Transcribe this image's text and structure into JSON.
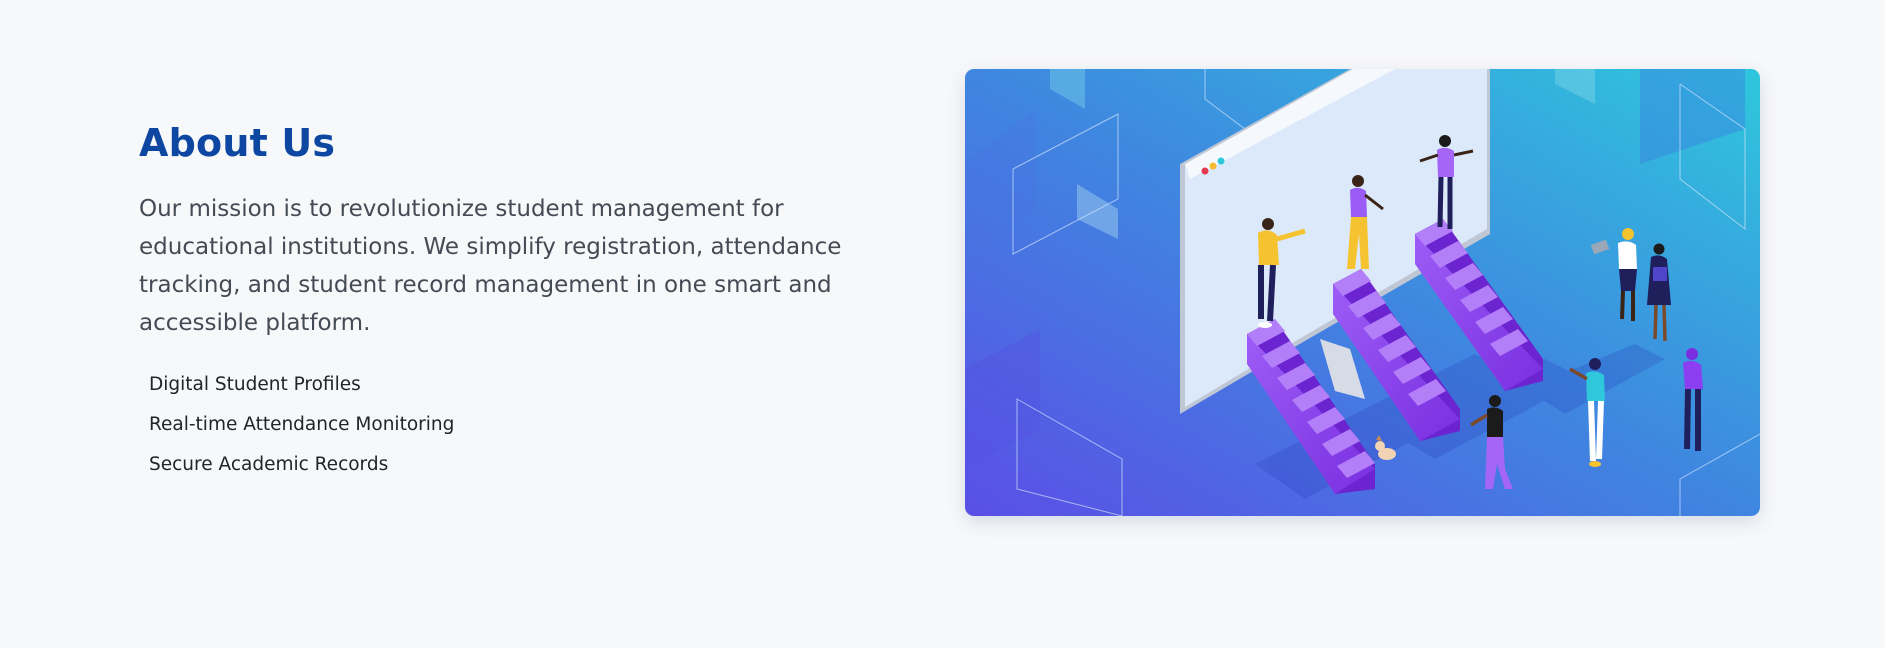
{
  "about": {
    "title": "About Us",
    "mission": "Our mission is to revolutionize student management for educational institutions. We simplify registration, attendance tracking, and student record management in one smart and accessible platform.",
    "features": [
      "Digital Student Profiles",
      "Real-time Attendance Monitoring",
      "Secure Academic Records"
    ]
  },
  "illustration": {
    "icon": "team-climbing-stairs-illustration",
    "colors": {
      "gradient_start": "#5a4fe6",
      "gradient_mid": "#3f86e0",
      "gradient_end": "#2ec7dc",
      "stairs": "#8b3ff0",
      "screen": "#dce9fb"
    }
  },
  "colors": {
    "title": "#0d47a1",
    "body_text": "#444b55",
    "background": "#f7f8fa"
  }
}
